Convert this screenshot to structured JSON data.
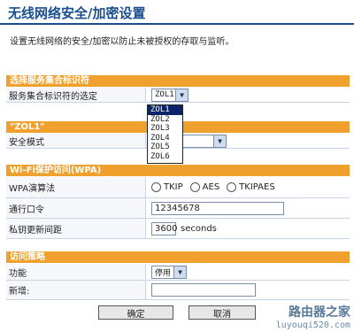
{
  "page": {
    "title": "无线网络安全/加密设置",
    "description": "设置无线网络的安全/加密以防止未被授权的存取与监听。"
  },
  "ssid_section": {
    "header": "选择服务集合标识符",
    "label": "服务集合标识符的选定",
    "selected": "ZOL1",
    "options": [
      "ZOL1",
      "ZOL2",
      "ZOL3",
      "ZOL4",
      "ZOL5",
      "ZOL6"
    ]
  },
  "zol1_section": {
    "header": "\"ZOL1\"",
    "security_label": "安全模式",
    "security_value": ""
  },
  "wpa_section": {
    "header": "Wi-Fi保护访问(WPA)",
    "algorithm_label": "WPA演算法",
    "algorithms": [
      "TKIP",
      "AES",
      "TKIPAES"
    ],
    "passphrase_label": "通行口令",
    "passphrase_value": "12345678",
    "rekey_label": "私钥更新间距",
    "rekey_value": "3600",
    "rekey_unit": "seconds"
  },
  "policy_section": {
    "header": "访问策略",
    "function_label": "功能",
    "function_value": "停用",
    "add_label": "新增:",
    "add_value": ""
  },
  "buttons": {
    "ok": "确定",
    "cancel": "取消"
  },
  "watermark": {
    "line1": "路由器之家",
    "line2": "luyouqi520.com"
  }
}
